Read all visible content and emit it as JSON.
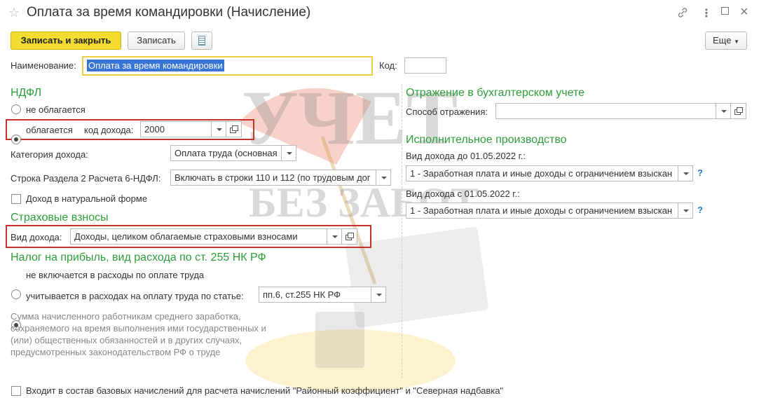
{
  "window": {
    "title": "Оплата за время командировки (Начисление)"
  },
  "toolbar": {
    "save_close": "Записать и закрыть",
    "save": "Записать",
    "more": "Еще"
  },
  "name_field": {
    "label": "Наименование:",
    "value": "Оплата за время командировки"
  },
  "code_field": {
    "label": "Код:",
    "value": ""
  },
  "ndfl": {
    "heading": "НДФЛ",
    "option_not_taxed": "не облагается",
    "option_taxed": "облагается",
    "income_code_label": "код дохода:",
    "income_code_value": "2000",
    "category_label": "Категория дохода:",
    "category_value": "Оплата труда (основная",
    "row6_label": "Строка Раздела 2 Расчета 6-НДФЛ:",
    "row6_value": "Включать в строки 110 и 112 (по трудовым дог",
    "in_kind_label": "Доход в натуральной форме"
  },
  "insurance": {
    "heading": "Страховые взносы",
    "income_type_label": "Вид дохода:",
    "income_type_value": "Доходы, целиком облагаемые страховыми взносами"
  },
  "profit_tax": {
    "heading": "Налог на прибыль, вид расхода по ст. 255 НК РФ",
    "option_not_included": "не включается в расходы по оплате труда",
    "option_included": "учитывается в расходах на оплату труда по статье:",
    "article_value": "пп.6, ст.255 НК РФ",
    "note": "Сумма начисленного работникам среднего заработка,\nсохраняемого на время выполнения ими государственных и\n(или) общественных обязанностей и в других случаях,\nпредусмотренных законодательством РФ о труде"
  },
  "accounting": {
    "heading": "Отражение в бухгалтерском учете",
    "method_label": "Способ отражения:",
    "method_value": ""
  },
  "enforcement": {
    "heading": "Исполнительное производство",
    "before_label": "Вид дохода до 01.05.2022 г.:",
    "before_value": "1 - Заработная плата и иные доходы с ограничением взыскан",
    "after_label": "Вид дохода с 01.05.2022 г.:",
    "after_value": "1 - Заработная плата и иные доходы с ограничением взыскан",
    "help": "?"
  },
  "base_accruals": {
    "label": "Входит в состав базовых начислений для расчета начислений \"Районный коэффициент\" и \"Северная надбавка\""
  },
  "watermark": {
    "line1": "УЧЕТ",
    "line2": "БЕЗ ЗАБОТ"
  },
  "colors": {
    "accent_section": "#2d9f3a",
    "primary_button": "#f4db2f",
    "highlight_box": "#c9312b",
    "selected_text_bg": "#3875d7",
    "help": "#1a7bd1"
  },
  "icons": {
    "favorite": "star-icon",
    "link": "link-icon",
    "menu": "more-vertical-icon",
    "maximize": "maximize-icon",
    "close": "close-icon",
    "report": "document-icon"
  }
}
